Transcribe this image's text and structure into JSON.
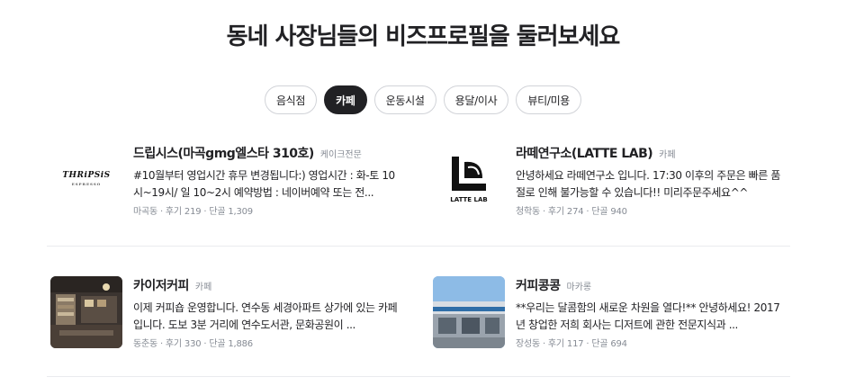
{
  "page": {
    "title": "동네 사장님들의 비즈프로필을 둘러보세요"
  },
  "tabs": [
    {
      "label": "음식점",
      "active": false
    },
    {
      "label": "카페",
      "active": true
    },
    {
      "label": "운동시설",
      "active": false
    },
    {
      "label": "용달/이사",
      "active": false
    },
    {
      "label": "뷰티/미용",
      "active": false
    }
  ],
  "cards": [
    {
      "name": "드립시스(마곡gmg엘스타 310호)",
      "category": "케이크전문",
      "description": "#10월부터 영업시간 휴무 변경됩니다:) 영업시간 : 화-토 10시~19시/ 일 10~2시 예약방법 : 네이버예약 또는 전...",
      "meta": "마곡동 · 후기 219 · 단골 1,309",
      "logo_text": "THRiPSiS",
      "logo_sub": "ESPRESSO"
    },
    {
      "name": "라떼연구소(LATTE LAB)",
      "category": "카페",
      "description": "안녕하세요 라떼연구소 입니다. 17:30 이후의 주문은 빠른 품절로 인해 불가능할 수 있습니다!! 미리주문주세요^^",
      "meta": "청학동 · 후기 274 · 단골 940",
      "logo_text": "LATTE LAB"
    },
    {
      "name": "카이저커피",
      "category": "카페",
      "description": "이제 커피숍 운영합니다. 연수동 세경아파트 상가에 있는 카페입니다. 도보 3분 거리에 연수도서관, 문화공원이 ...",
      "meta": "동춘동 · 후기 330 · 단골 1,886"
    },
    {
      "name": "커피콩콩",
      "category": "마카롱",
      "description": "**우리는 달콤함의 새로운 차원을 열다!** 안녕하세요! 2017년 창업한 저희 회사는 디저트에 관한 전문지식과 ...",
      "meta": "장성동 · 후기 117 · 단골 694"
    }
  ]
}
